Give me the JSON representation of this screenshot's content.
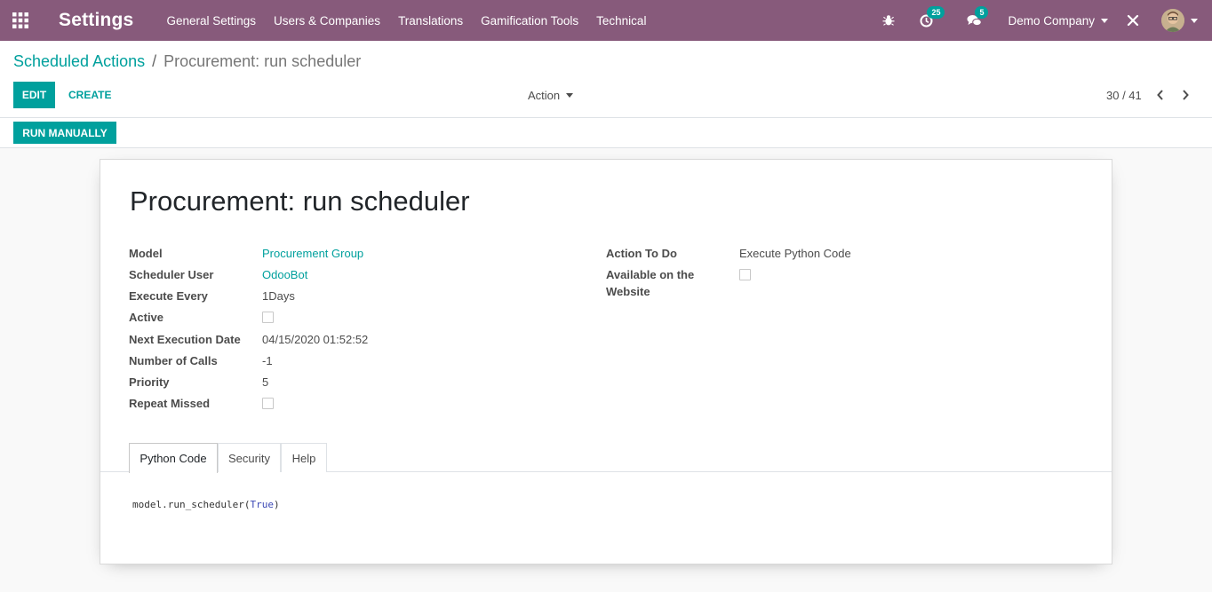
{
  "navbar": {
    "app_title": "Settings",
    "menu": [
      "General Settings",
      "Users & Companies",
      "Translations",
      "Gamification Tools",
      "Technical"
    ],
    "activity_count": "25",
    "messages_count": "5",
    "company": "Demo Company",
    "brand_color": "#875a7b",
    "accent_color": "#00a09d"
  },
  "breadcrumb": {
    "parent": "Scheduled Actions",
    "separator": "/",
    "current": "Procurement: run scheduler"
  },
  "toolbar": {
    "edit": "Edit",
    "create": "Create",
    "action": "Action",
    "pager": "30 / 41"
  },
  "statusbar": {
    "run_manually": "Run Manually"
  },
  "record": {
    "title": "Procurement: run scheduler",
    "left_fields": {
      "model_label": "Model",
      "model_value": "Procurement Group",
      "user_label": "Scheduler User",
      "user_value": "OdooBot",
      "interval_label": "Execute Every",
      "interval_value": "1Days",
      "active_label": "Active",
      "active_value": false,
      "nextcall_label": "Next Execution Date",
      "nextcall_value": "04/15/2020 01:52:52",
      "numcall_label": "Number of Calls",
      "numcall_value": "-1",
      "priority_label": "Priority",
      "priority_value": "5",
      "repeat_label": "Repeat Missed",
      "repeat_value": false
    },
    "right_fields": {
      "action_label": "Action To Do",
      "action_value": "Execute Python Code",
      "website_label_1": "Available on the",
      "website_label_2": "Website",
      "website_value": false
    }
  },
  "tabs": [
    "Python Code",
    "Security",
    "Help"
  ],
  "code": {
    "prefix": "model.run_scheduler(",
    "keyword": "True",
    "suffix": ")"
  }
}
